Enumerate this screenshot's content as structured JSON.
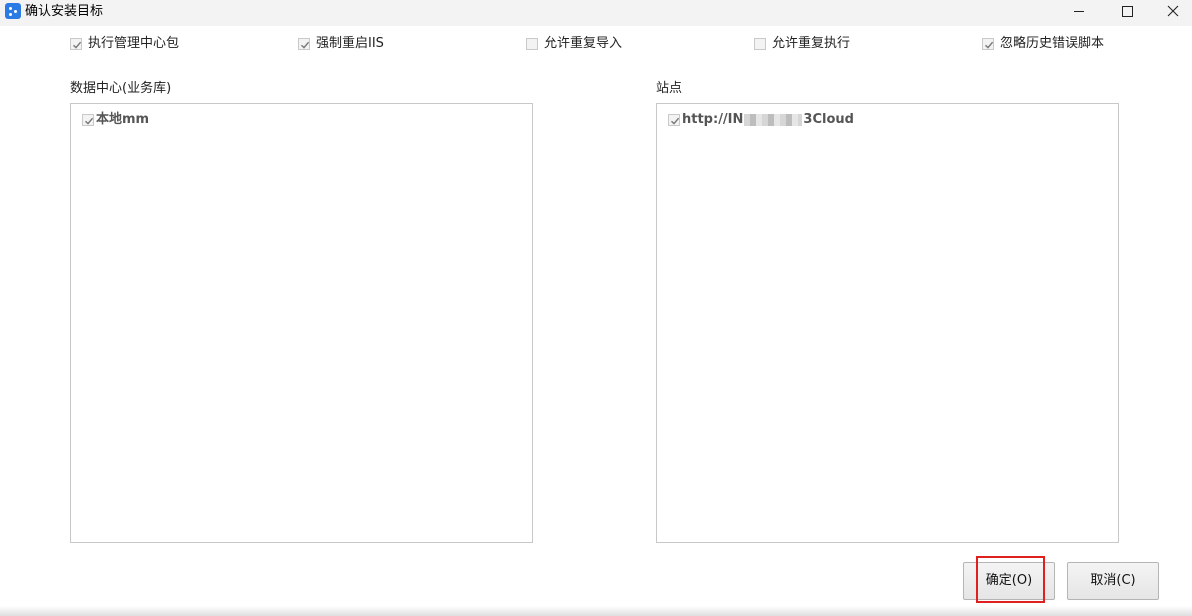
{
  "window": {
    "title": "确认安装目标",
    "icons": {
      "app": "app-logo-icon",
      "minimize": "minimize-icon",
      "maximize": "maximize-icon",
      "close": "close-icon"
    }
  },
  "options": [
    {
      "label": "执行管理中心包",
      "checked": true
    },
    {
      "label": "强制重启IIS",
      "checked": true
    },
    {
      "label": "允许重复导入",
      "checked": false
    },
    {
      "label": "允许重复执行",
      "checked": false
    },
    {
      "label": "忽略历史错误脚本",
      "checked": true
    }
  ],
  "datacenter": {
    "label": "数据中心(业务库)",
    "items": [
      {
        "label": "本地mm",
        "checked": true
      }
    ]
  },
  "site": {
    "label": "站点",
    "items": [
      {
        "label_prefix": "http://IN",
        "label_suffix": "3Cloud",
        "checked": true,
        "redacted": true
      }
    ]
  },
  "buttons": {
    "ok": "确定(O)",
    "cancel": "取消(C)"
  },
  "colors": {
    "highlight": "#e0201f",
    "titlebar": "#f3f3f3",
    "app_icon": "#2b7be4"
  }
}
